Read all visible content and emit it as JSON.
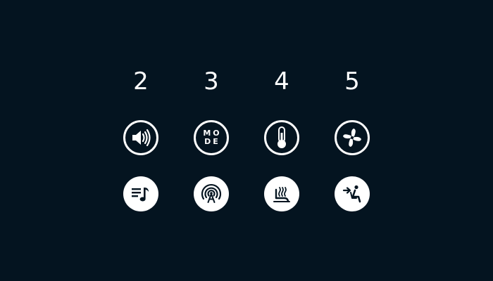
{
  "columns": [
    {
      "number": "2",
      "top_icon": "volume-icon",
      "bottom_icon": "playlist-music-icon"
    },
    {
      "number": "3",
      "top_icon": "mode-icon",
      "top_text_line1": "MO",
      "top_text_line2": "DE",
      "bottom_icon": "radio-antenna-icon"
    },
    {
      "number": "4",
      "top_icon": "temperature-icon",
      "bottom_icon": "heated-seat-icon"
    },
    {
      "number": "5",
      "top_icon": "fan-icon",
      "bottom_icon": "seat-airflow-icon"
    }
  ],
  "colors": {
    "background": "#041420",
    "foreground": "#ffffff"
  }
}
